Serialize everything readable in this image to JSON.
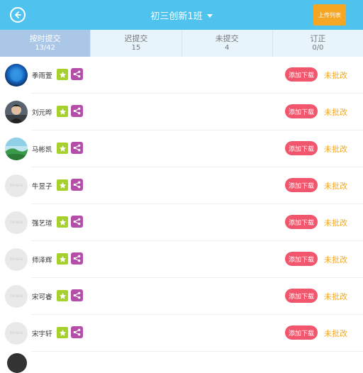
{
  "header": {
    "title": "初三创新1班",
    "upload_label": "上传列表"
  },
  "tabs": [
    {
      "label": "按时提交",
      "count": "13/42",
      "active": true
    },
    {
      "label": "迟提交",
      "count": "15",
      "active": false
    },
    {
      "label": "未提交",
      "count": "4",
      "active": false
    },
    {
      "label": "订正",
      "count": "0/0",
      "active": false
    }
  ],
  "placeholder_text": "ZHIWEN",
  "students": [
    {
      "name": "季雨萱",
      "download_label": "添加下载",
      "status": "未批改",
      "avatar": "photo-globe"
    },
    {
      "name": "刘元晔",
      "download_label": "添加下载",
      "status": "未批改",
      "avatar": "photo-person"
    },
    {
      "name": "马彬凯",
      "download_label": "添加下载",
      "status": "未批改",
      "avatar": "photo-landscape"
    },
    {
      "name": "牛昱子",
      "download_label": "添加下载",
      "status": "未批改",
      "avatar": "placeholder"
    },
    {
      "name": "强艺瑄",
      "download_label": "添加下载",
      "status": "未批改",
      "avatar": "placeholder"
    },
    {
      "name": "师泽辉",
      "download_label": "添加下载",
      "status": "未批改",
      "avatar": "placeholder"
    },
    {
      "name": "宋可睿",
      "download_label": "添加下载",
      "status": "未批改",
      "avatar": "placeholder"
    },
    {
      "name": "宋宇轩",
      "download_label": "添加下载",
      "status": "未批改",
      "avatar": "placeholder"
    }
  ],
  "colors": {
    "header_bg": "#4fc3ee",
    "upload_bg": "#f5a623",
    "tab_active_bg": "#aac7e8",
    "star_bg": "#a8d02c",
    "share_bg": "#b54ea8",
    "download_bg": "#f2566c",
    "status_color": "#f5a623"
  },
  "icons": {
    "back": "back-arrow-icon",
    "dropdown": "caret-down-icon",
    "star": "star-icon",
    "share": "share-icon"
  }
}
